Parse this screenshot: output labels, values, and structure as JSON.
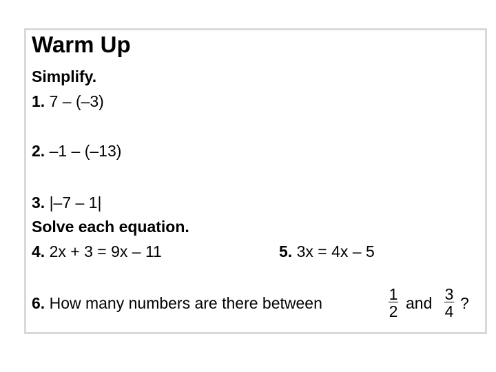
{
  "title": "Warm Up",
  "sections": {
    "simplify": "Simplify.",
    "solve": "Solve each equation."
  },
  "problems": [
    {
      "number": "1.",
      "expr": " 7 – (–3)"
    },
    {
      "number": "2.",
      "expr": "–1 – (–13)"
    },
    {
      "number": "3.",
      "expr": "|–7 – 1|"
    },
    {
      "number": "4.",
      "expr": "2x + 3 = 9x – 11"
    },
    {
      "number": "5.",
      "expr": "3x = 4x – 5"
    },
    {
      "number": "6.",
      "expr": "How many numbers are there between",
      "and": "and",
      "end": "?",
      "frac1": {
        "num": "1",
        "den": "2"
      },
      "frac2": {
        "num": "3",
        "den": "4"
      }
    }
  ]
}
